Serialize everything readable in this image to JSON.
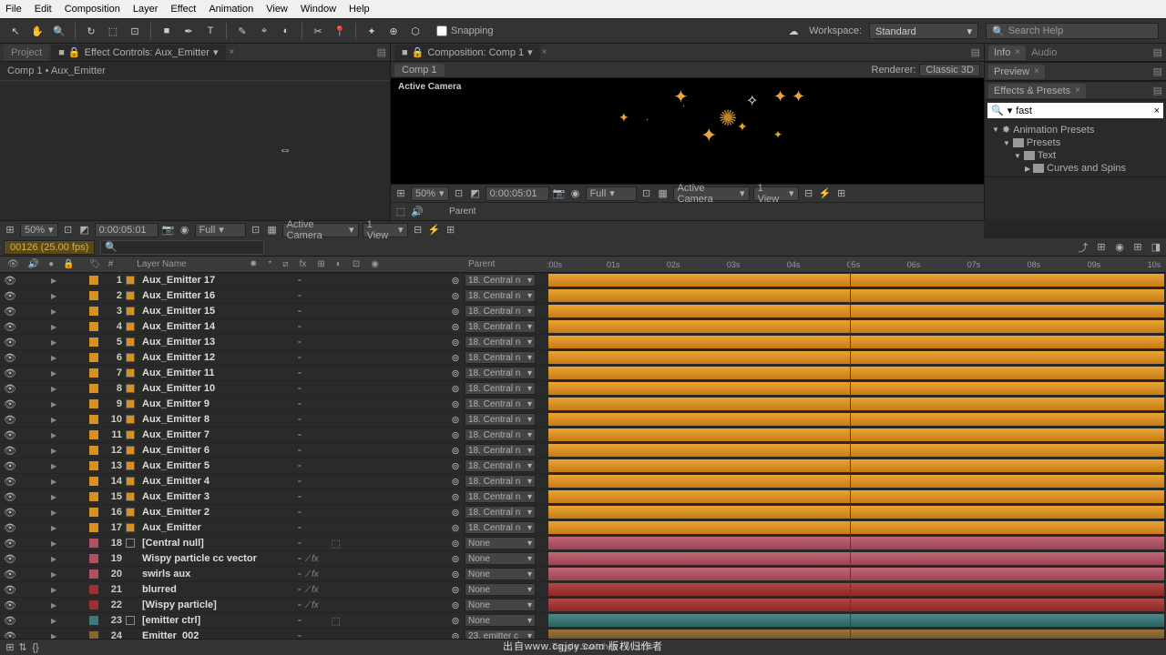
{
  "menu": [
    "File",
    "Edit",
    "Composition",
    "Layer",
    "Effect",
    "Animation",
    "View",
    "Window",
    "Help"
  ],
  "toolbar": {
    "snapping": "Snapping",
    "workspace_label": "Workspace:",
    "workspace_value": "Standard",
    "search_placeholder": "Search Help"
  },
  "leftPanel": {
    "tabs": {
      "project": "Project",
      "fx": "Effect Controls: Aux_Emitter"
    },
    "breadcrumb": "Comp 1 • Aux_Emitter"
  },
  "comp": {
    "tabLabel": "Composition: Comp 1",
    "subtab": "Comp 1",
    "renderer_label": "Renderer:",
    "renderer_value": "Classic 3D",
    "viewer_label": "Active Camera",
    "zoom": "50%",
    "timecode": "0:00:05:01",
    "resolution": "Full",
    "camera": "Active Camera",
    "views": "1 View"
  },
  "sidePanels": {
    "info": "Info",
    "audio": "Audio",
    "preview": "Preview",
    "effects": "Effects & Presets",
    "search_value": "fast",
    "tree": {
      "root": "Animation Presets",
      "l1": "Presets",
      "l2": "Text",
      "l3": "Curves and Spins"
    }
  },
  "timeline": {
    "badge": "00126 (25.00 fps)",
    "col_num": "#",
    "col_layer": "Layer Name",
    "col_parent": "Parent",
    "toggle": "Toggle Switches / Modes",
    "ruler": [
      ":00s",
      "01s",
      "02s",
      "03s",
      "04s",
      "05s",
      "06s",
      "07s",
      "08s",
      "09s",
      "10s"
    ],
    "playhead_pos_pct": 49,
    "layers": [
      {
        "n": 1,
        "name": "Aux_Emitter 17",
        "parent": "18. Central n",
        "color": "orange",
        "bar": "orange",
        "chip": "solid",
        "fx": false,
        "cube": false
      },
      {
        "n": 2,
        "name": "Aux_Emitter 16",
        "parent": "18. Central n",
        "color": "orange",
        "bar": "orange",
        "chip": "solid",
        "fx": false,
        "cube": false
      },
      {
        "n": 3,
        "name": "Aux_Emitter 15",
        "parent": "18. Central n",
        "color": "orange",
        "bar": "orange",
        "chip": "solid",
        "fx": false,
        "cube": false
      },
      {
        "n": 4,
        "name": "Aux_Emitter 14",
        "parent": "18. Central n",
        "color": "orange",
        "bar": "orange",
        "chip": "solid",
        "fx": false,
        "cube": false
      },
      {
        "n": 5,
        "name": "Aux_Emitter 13",
        "parent": "18. Central n",
        "color": "orange",
        "bar": "orange",
        "chip": "solid",
        "fx": false,
        "cube": false
      },
      {
        "n": 6,
        "name": "Aux_Emitter 12",
        "parent": "18. Central n",
        "color": "orange",
        "bar": "orange",
        "chip": "solid",
        "fx": false,
        "cube": false
      },
      {
        "n": 7,
        "name": "Aux_Emitter 11",
        "parent": "18. Central n",
        "color": "orange",
        "bar": "orange",
        "chip": "solid",
        "fx": false,
        "cube": false
      },
      {
        "n": 8,
        "name": "Aux_Emitter 10",
        "parent": "18. Central n",
        "color": "orange",
        "bar": "orange",
        "chip": "solid",
        "fx": false,
        "cube": false
      },
      {
        "n": 9,
        "name": "Aux_Emitter 9",
        "parent": "18. Central n",
        "color": "orange",
        "bar": "orange",
        "chip": "solid",
        "fx": false,
        "cube": false
      },
      {
        "n": 10,
        "name": "Aux_Emitter 8",
        "parent": "18. Central n",
        "color": "orange",
        "bar": "orange",
        "chip": "solid",
        "fx": false,
        "cube": false
      },
      {
        "n": 11,
        "name": "Aux_Emitter 7",
        "parent": "18. Central n",
        "color": "orange",
        "bar": "orange",
        "chip": "solid",
        "fx": false,
        "cube": false
      },
      {
        "n": 12,
        "name": "Aux_Emitter 6",
        "parent": "18. Central n",
        "color": "orange",
        "bar": "orange",
        "chip": "solid",
        "fx": false,
        "cube": false
      },
      {
        "n": 13,
        "name": "Aux_Emitter 5",
        "parent": "18. Central n",
        "color": "orange",
        "bar": "orange",
        "chip": "solid",
        "fx": false,
        "cube": false
      },
      {
        "n": 14,
        "name": "Aux_Emitter 4",
        "parent": "18. Central n",
        "color": "orange",
        "bar": "orange",
        "chip": "solid",
        "fx": false,
        "cube": false
      },
      {
        "n": 15,
        "name": "Aux_Emitter 3",
        "parent": "18. Central n",
        "color": "orange",
        "bar": "orange",
        "chip": "solid",
        "fx": false,
        "cube": false
      },
      {
        "n": 16,
        "name": "Aux_Emitter 2",
        "parent": "18. Central n",
        "color": "orange",
        "bar": "orange",
        "chip": "solid",
        "fx": false,
        "cube": false
      },
      {
        "n": 17,
        "name": "Aux_Emitter",
        "parent": "18. Central n",
        "color": "orange",
        "bar": "orange",
        "chip": "solid",
        "fx": false,
        "cube": false
      },
      {
        "n": 18,
        "name": "[Central null]",
        "parent": "None",
        "color": "pink",
        "bar": "pink",
        "chip": "hollow",
        "fx": false,
        "cube": true
      },
      {
        "n": 19,
        "name": "Wispy particle cc vector",
        "parent": "None",
        "color": "pink",
        "bar": "pink",
        "chip": "none",
        "fx": true,
        "cube": false
      },
      {
        "n": 20,
        "name": "swirls aux",
        "parent": "None",
        "color": "pink",
        "bar": "pink",
        "chip": "none",
        "fx": true,
        "cube": false
      },
      {
        "n": 21,
        "name": "blurred",
        "parent": "None",
        "color": "red",
        "bar": "red",
        "chip": "none",
        "fx": true,
        "cube": false
      },
      {
        "n": 22,
        "name": "[Wispy particle]",
        "parent": "None",
        "color": "red",
        "bar": "red",
        "chip": "none",
        "fx": true,
        "cube": false
      },
      {
        "n": 23,
        "name": "[emitter ctrl]",
        "parent": "None",
        "color": "teal",
        "bar": "teal",
        "chip": "hollow",
        "fx": false,
        "cube": true
      },
      {
        "n": 24,
        "name": "Emitter_002",
        "parent": "23. emitter c",
        "color": "brown",
        "bar": "brown",
        "chip": "none",
        "fx": false,
        "cube": false
      }
    ]
  },
  "watermark": "出自www.cgjoy.com 版权归作者"
}
